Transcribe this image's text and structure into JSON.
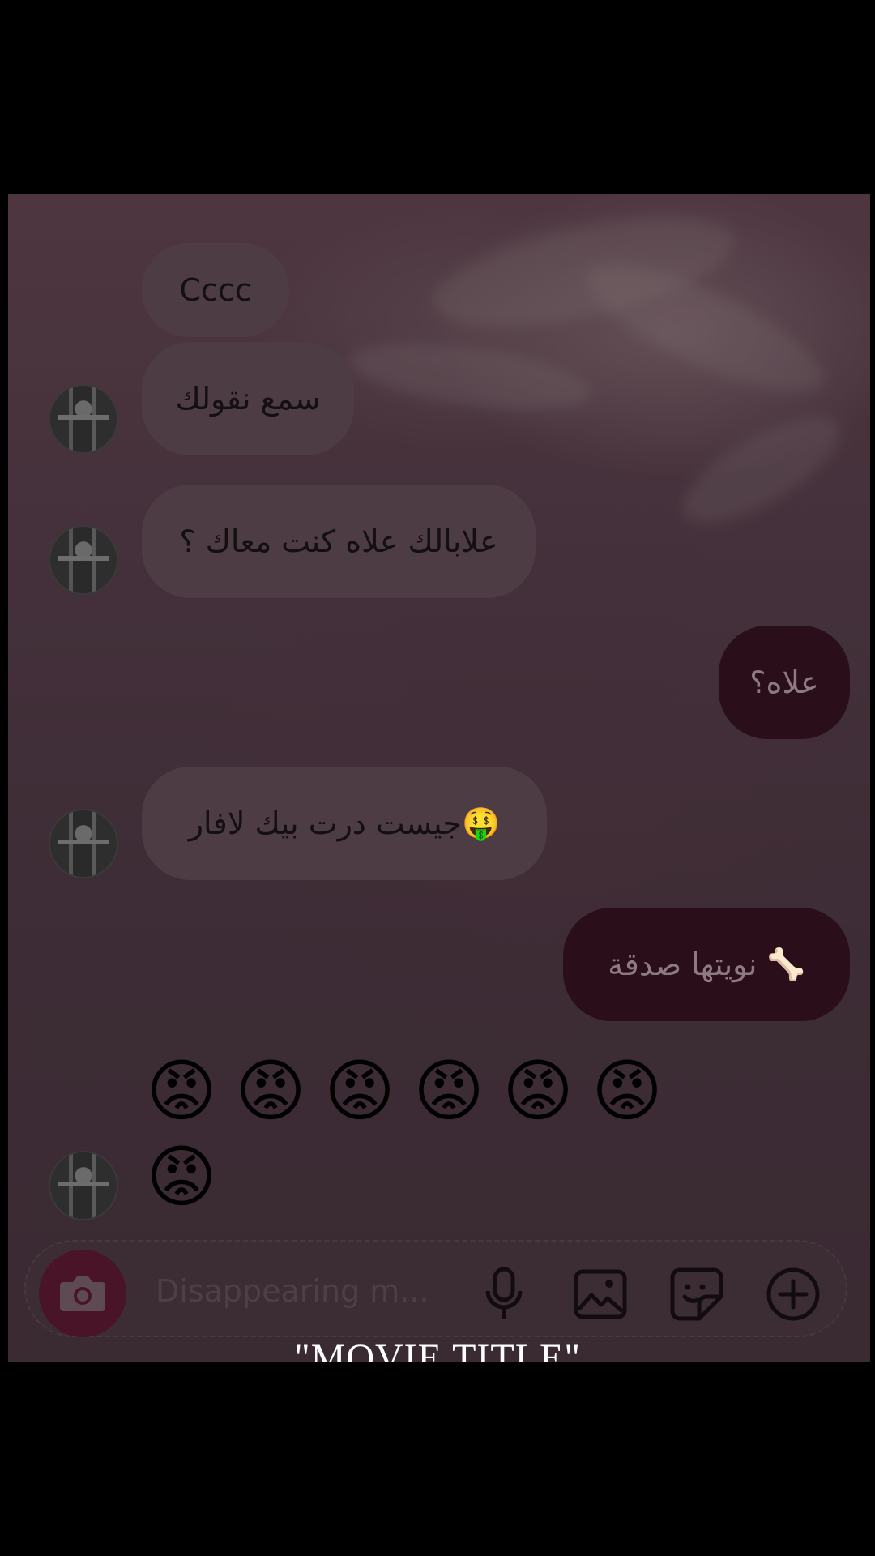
{
  "messages": [
    {
      "direction": "incoming",
      "text": "Cccc"
    },
    {
      "direction": "incoming",
      "text": "سمع نقولك"
    },
    {
      "direction": "incoming",
      "text": "علابالك علاه كنت معاك ؟"
    },
    {
      "direction": "outgoing",
      "text": "علاه؟"
    },
    {
      "direction": "incoming",
      "text": "🤑جيست درت بيك لافار"
    },
    {
      "direction": "outgoing",
      "text": "🦴 نويتها صدقة"
    },
    {
      "direction": "incoming",
      "emoji": "😡",
      "count": 7
    }
  ],
  "composer": {
    "placeholder": "Disappearing m..."
  },
  "overlay": {
    "title": "\"MOVIE TITLE\""
  },
  "icons": {
    "camera": "camera-icon",
    "mic": "microphone-icon",
    "gallery": "gallery-icon",
    "sticker": "sticker-icon",
    "plus": "plus-circle-icon"
  },
  "colors": {
    "incoming_bubble": "#4d3c44",
    "outgoing_bubble": "#2a0e1a",
    "camera_button": "#4a1428"
  }
}
